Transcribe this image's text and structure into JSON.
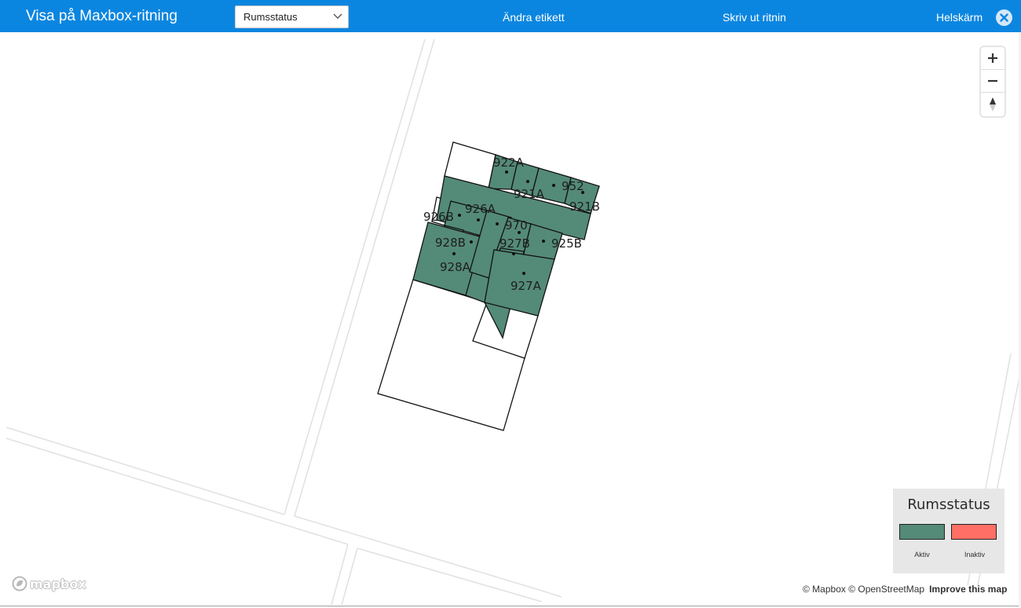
{
  "header": {
    "title": "Visa på Maxbox-ritning",
    "select_value": "Rumsstatus",
    "edit_label": "Ändra etikett",
    "print_label": "Skriv ut ritnin",
    "fullscreen_label": "Helskärm",
    "bar_color": "#0b86e0"
  },
  "map": {
    "rooms": [
      {
        "label": "922A",
        "status": "Aktiv"
      },
      {
        "label": "921A",
        "status": "Aktiv"
      },
      {
        "label": "952",
        "status": "Aktiv"
      },
      {
        "label": "921B",
        "status": "Aktiv"
      },
      {
        "label": "926B",
        "status": "Aktiv"
      },
      {
        "label": "926A",
        "status": "Aktiv"
      },
      {
        "label": "970",
        "status": "Aktiv"
      },
      {
        "label": "928B",
        "status": "Aktiv"
      },
      {
        "label": "927B",
        "status": "Aktiv"
      },
      {
        "label": "925B",
        "status": "Aktiv"
      },
      {
        "label": "928A",
        "status": "Aktiv"
      },
      {
        "label": "927A",
        "status": "Aktiv"
      }
    ],
    "active_color": "#548a78",
    "inactive_color": "#ff6f66"
  },
  "controls": {
    "zoom_in_icon": "plus-icon",
    "zoom_out_icon": "minus-icon",
    "compass_icon": "compass-icon"
  },
  "legend": {
    "title": "Rumsstatus",
    "items": [
      {
        "label": "Aktiv",
        "color": "#548a78"
      },
      {
        "label": "Inaktiv",
        "color": "#ff6f66"
      }
    ]
  },
  "footer": {
    "logo_text": "mapbox",
    "attribution": "© Mapbox © OpenStreetMap",
    "improve_label": "Improve this map"
  }
}
